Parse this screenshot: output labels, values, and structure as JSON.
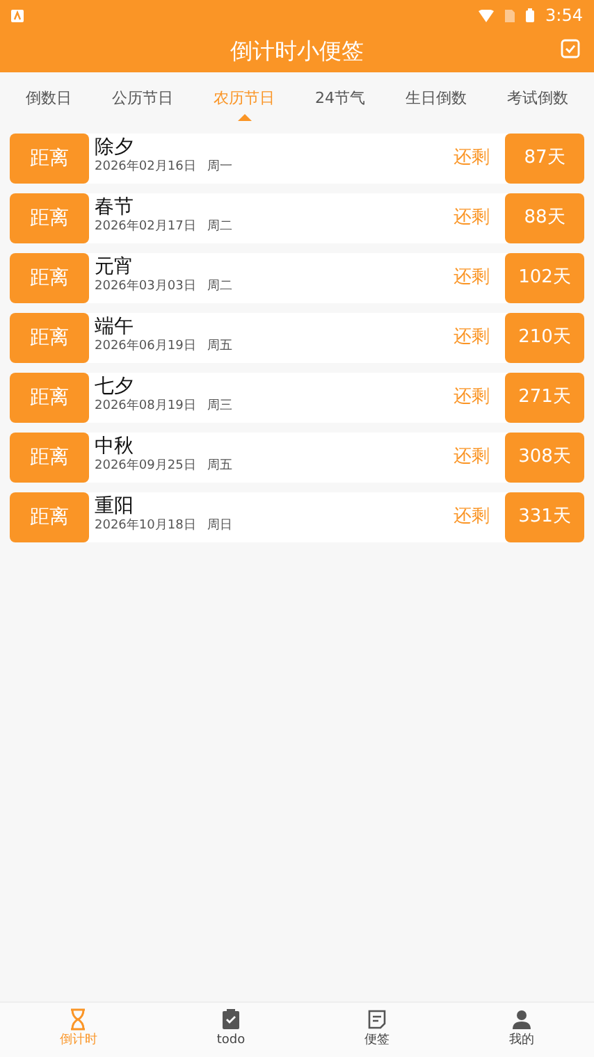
{
  "status_bar": {
    "time": "3:54"
  },
  "header": {
    "title": "倒计时小便签"
  },
  "tabs": [
    {
      "label": "倒数日",
      "selected": false
    },
    {
      "label": "公历节日",
      "selected": false
    },
    {
      "label": "农历节日",
      "selected": true
    },
    {
      "label": "24节气",
      "selected": false
    },
    {
      "label": "生日倒数",
      "selected": false
    },
    {
      "label": "考试倒数",
      "selected": false
    }
  ],
  "events": [
    {
      "prefix": "距离",
      "name": "除夕",
      "date": "2026年02月16日",
      "weekday": "周一",
      "remain_label": "还剩",
      "days": "87天"
    },
    {
      "prefix": "距离",
      "name": "春节",
      "date": "2026年02月17日",
      "weekday": "周二",
      "remain_label": "还剩",
      "days": "88天"
    },
    {
      "prefix": "距离",
      "name": "元宵",
      "date": "2026年03月03日",
      "weekday": "周二",
      "remain_label": "还剩",
      "days": "102天"
    },
    {
      "prefix": "距离",
      "name": "端午",
      "date": "2026年06月19日",
      "weekday": "周五",
      "remain_label": "还剩",
      "days": "210天"
    },
    {
      "prefix": "距离",
      "name": "七夕",
      "date": "2026年08月19日",
      "weekday": "周三",
      "remain_label": "还剩",
      "days": "271天"
    },
    {
      "prefix": "距离",
      "name": "中秋",
      "date": "2026年09月25日",
      "weekday": "周五",
      "remain_label": "还剩",
      "days": "308天"
    },
    {
      "prefix": "距离",
      "name": "重阳",
      "date": "2026年10月18日",
      "weekday": "周日",
      "remain_label": "还剩",
      "days": "331天"
    }
  ],
  "bottom_nav": [
    {
      "label": "倒计时",
      "selected": true
    },
    {
      "label": "todo",
      "selected": false
    },
    {
      "label": "便签",
      "selected": false
    },
    {
      "label": "我的",
      "selected": false
    }
  ]
}
